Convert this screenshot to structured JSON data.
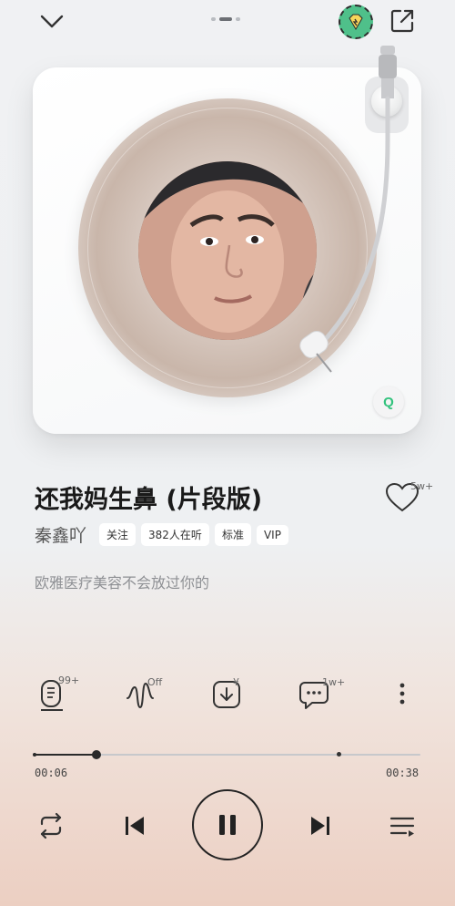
{
  "song": {
    "title": "还我妈生鼻 (片段版)",
    "artist": "秦鑫吖",
    "tags": [
      "关注",
      "382人在听",
      "标准",
      "VIP"
    ],
    "lyric": "欧雅医疗美容不会放过你的",
    "like_count": "5w+"
  },
  "actions": {
    "lyrics_badge": "99+",
    "sound_effect_badge": "Off",
    "download_badge": "¥",
    "comment_badge": "1w+"
  },
  "progress": {
    "current": "00:06",
    "total": "00:38",
    "fraction": 0.16
  },
  "colors": {
    "brand_green": "#31c27c",
    "vip_badge_green": "#4fc08a",
    "progress_active": "#2a2a2a"
  },
  "icons": [
    "chevron-down-icon",
    "vip-diamond-icon",
    "share-icon",
    "qq-music-logo-icon",
    "heart-icon",
    "lyrics-icon",
    "sound-effect-icon",
    "download-icon",
    "comment-icon",
    "more-icon",
    "repeat-icon",
    "previous-icon",
    "pause-icon",
    "next-icon",
    "playlist-icon"
  ]
}
